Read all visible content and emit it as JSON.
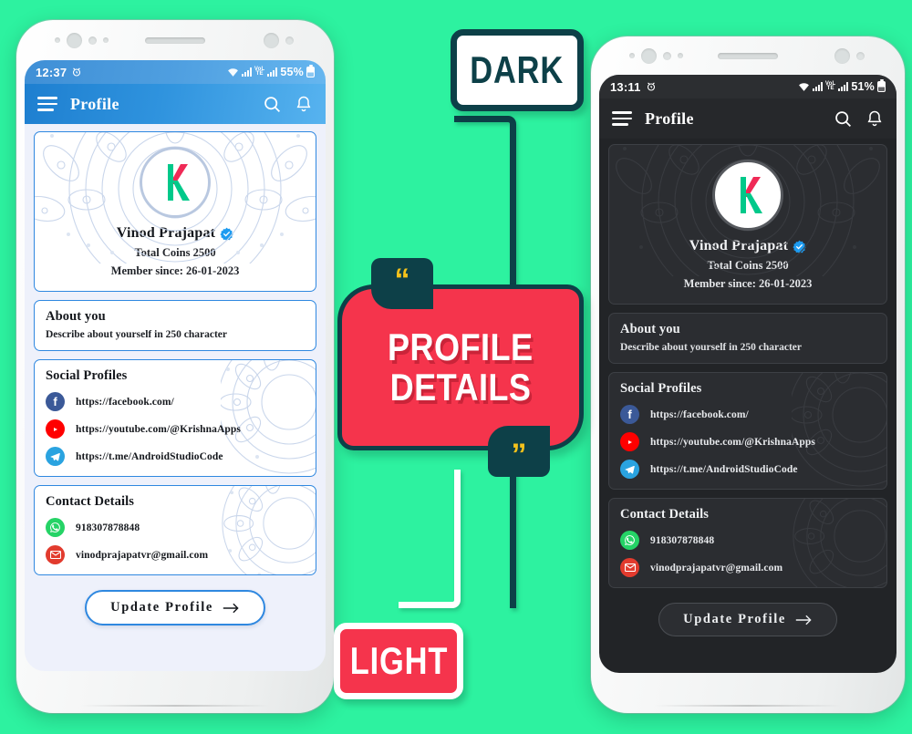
{
  "background_color": "#2df2a0",
  "labels": {
    "dark_tag": "DARK",
    "light_tag": "LIGHT",
    "banner_line1": "PROFILE",
    "banner_line2": "DETAILS",
    "quote_open": "“",
    "quote_close": "”"
  },
  "colors": {
    "accent_red": "#f5344c",
    "accent_teal": "#0d4048",
    "light_appbar": "#2f93de",
    "dark_appbar": "#26282b",
    "verified_blue": "#1d9bf0"
  },
  "light_phone": {
    "status": {
      "time": "12:37",
      "battery": "55%",
      "alarm_icon": "alarm-icon",
      "wifi_icon": "wifi-icon",
      "signal_icon": "signal-icon",
      "volte_icon": "volte-icon"
    },
    "appbar": {
      "title": "Profile",
      "menu_icon": "hamburger-icon",
      "search_icon": "search-icon",
      "bell_icon": "notification-bell-icon"
    },
    "profile": {
      "name": "Vinod Prajapat",
      "verified_icon": "verified-badge-icon",
      "coins": "Total Coins 2500",
      "member_since": "Member since: 26-01-2023",
      "avatar_letter": "K"
    },
    "about": {
      "heading": "About you",
      "text": "Describe about yourself in 250 character"
    },
    "social": {
      "heading": "Social Profiles",
      "rows": [
        {
          "icon": "facebook-icon",
          "url": "https://facebook.com/"
        },
        {
          "icon": "youtube-icon",
          "url": "https://youtube.com/@KrishnaApps"
        },
        {
          "icon": "telegram-icon",
          "url": "https://t.me/AndroidStudioCode"
        }
      ]
    },
    "contact": {
      "heading": "Contact Details",
      "rows": [
        {
          "icon": "whatsapp-icon",
          "value": "918307878848"
        },
        {
          "icon": "email-icon",
          "value": "vinodprajapatvr@gmail.com"
        }
      ]
    },
    "update_button": {
      "label": "Update Profile",
      "arrow_icon": "arrow-right-icon"
    }
  },
  "dark_phone": {
    "status": {
      "time": "13:11",
      "battery": "51%",
      "alarm_icon": "alarm-icon",
      "wifi_icon": "wifi-icon",
      "signal_icon": "signal-icon",
      "volte_icon": "volte-icon"
    },
    "appbar": {
      "title": "Profile",
      "menu_icon": "hamburger-icon",
      "search_icon": "search-icon",
      "bell_icon": "notification-bell-icon"
    },
    "profile": {
      "name": "Vinod Prajapat",
      "verified_icon": "verified-badge-icon",
      "coins": "Total Coins 2500",
      "member_since": "Member since: 26-01-2023",
      "avatar_letter": "K"
    },
    "about": {
      "heading": "About you",
      "text": "Describe about yourself in 250 character"
    },
    "social": {
      "heading": "Social Profiles",
      "rows": [
        {
          "icon": "facebook-icon",
          "url": "https://facebook.com/"
        },
        {
          "icon": "youtube-icon",
          "url": "https://youtube.com/@KrishnaApps"
        },
        {
          "icon": "telegram-icon",
          "url": "https://t.me/AndroidStudioCode"
        }
      ]
    },
    "contact": {
      "heading": "Contact Details",
      "rows": [
        {
          "icon": "whatsapp-icon",
          "value": "918307878848"
        },
        {
          "icon": "email-icon",
          "value": "vinodprajapatvr@gmail.com"
        }
      ]
    },
    "update_button": {
      "label": "Update Profile",
      "arrow_icon": "arrow-right-icon"
    }
  }
}
